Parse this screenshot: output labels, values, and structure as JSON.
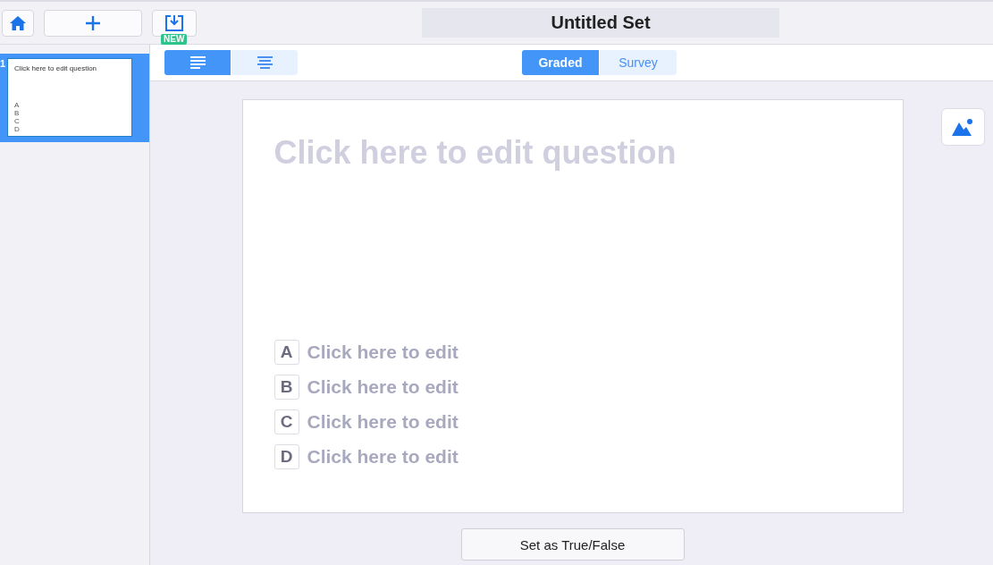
{
  "top_bar": {
    "new_badge": "NEW",
    "title": "Untitled Set"
  },
  "slides": [
    {
      "number": "1",
      "selected": true,
      "question": "Click here to edit question",
      "choices": [
        "A",
        "B",
        "C",
        "D"
      ]
    }
  ],
  "align_buttons": [
    {
      "kind": "left",
      "selected": true
    },
    {
      "kind": "center",
      "selected": false
    }
  ],
  "mode_tabs": [
    {
      "label": "Graded",
      "selected": true
    },
    {
      "label": "Survey",
      "selected": false
    }
  ],
  "question": {
    "placeholder": "Click here to edit question"
  },
  "answers": [
    {
      "letter": "A",
      "placeholder": "Click here to edit"
    },
    {
      "letter": "B",
      "placeholder": "Click here to edit"
    },
    {
      "letter": "C",
      "placeholder": "Click here to edit"
    },
    {
      "letter": "D",
      "placeholder": "Click here to edit"
    }
  ],
  "true_false_button": "Set as True/False"
}
